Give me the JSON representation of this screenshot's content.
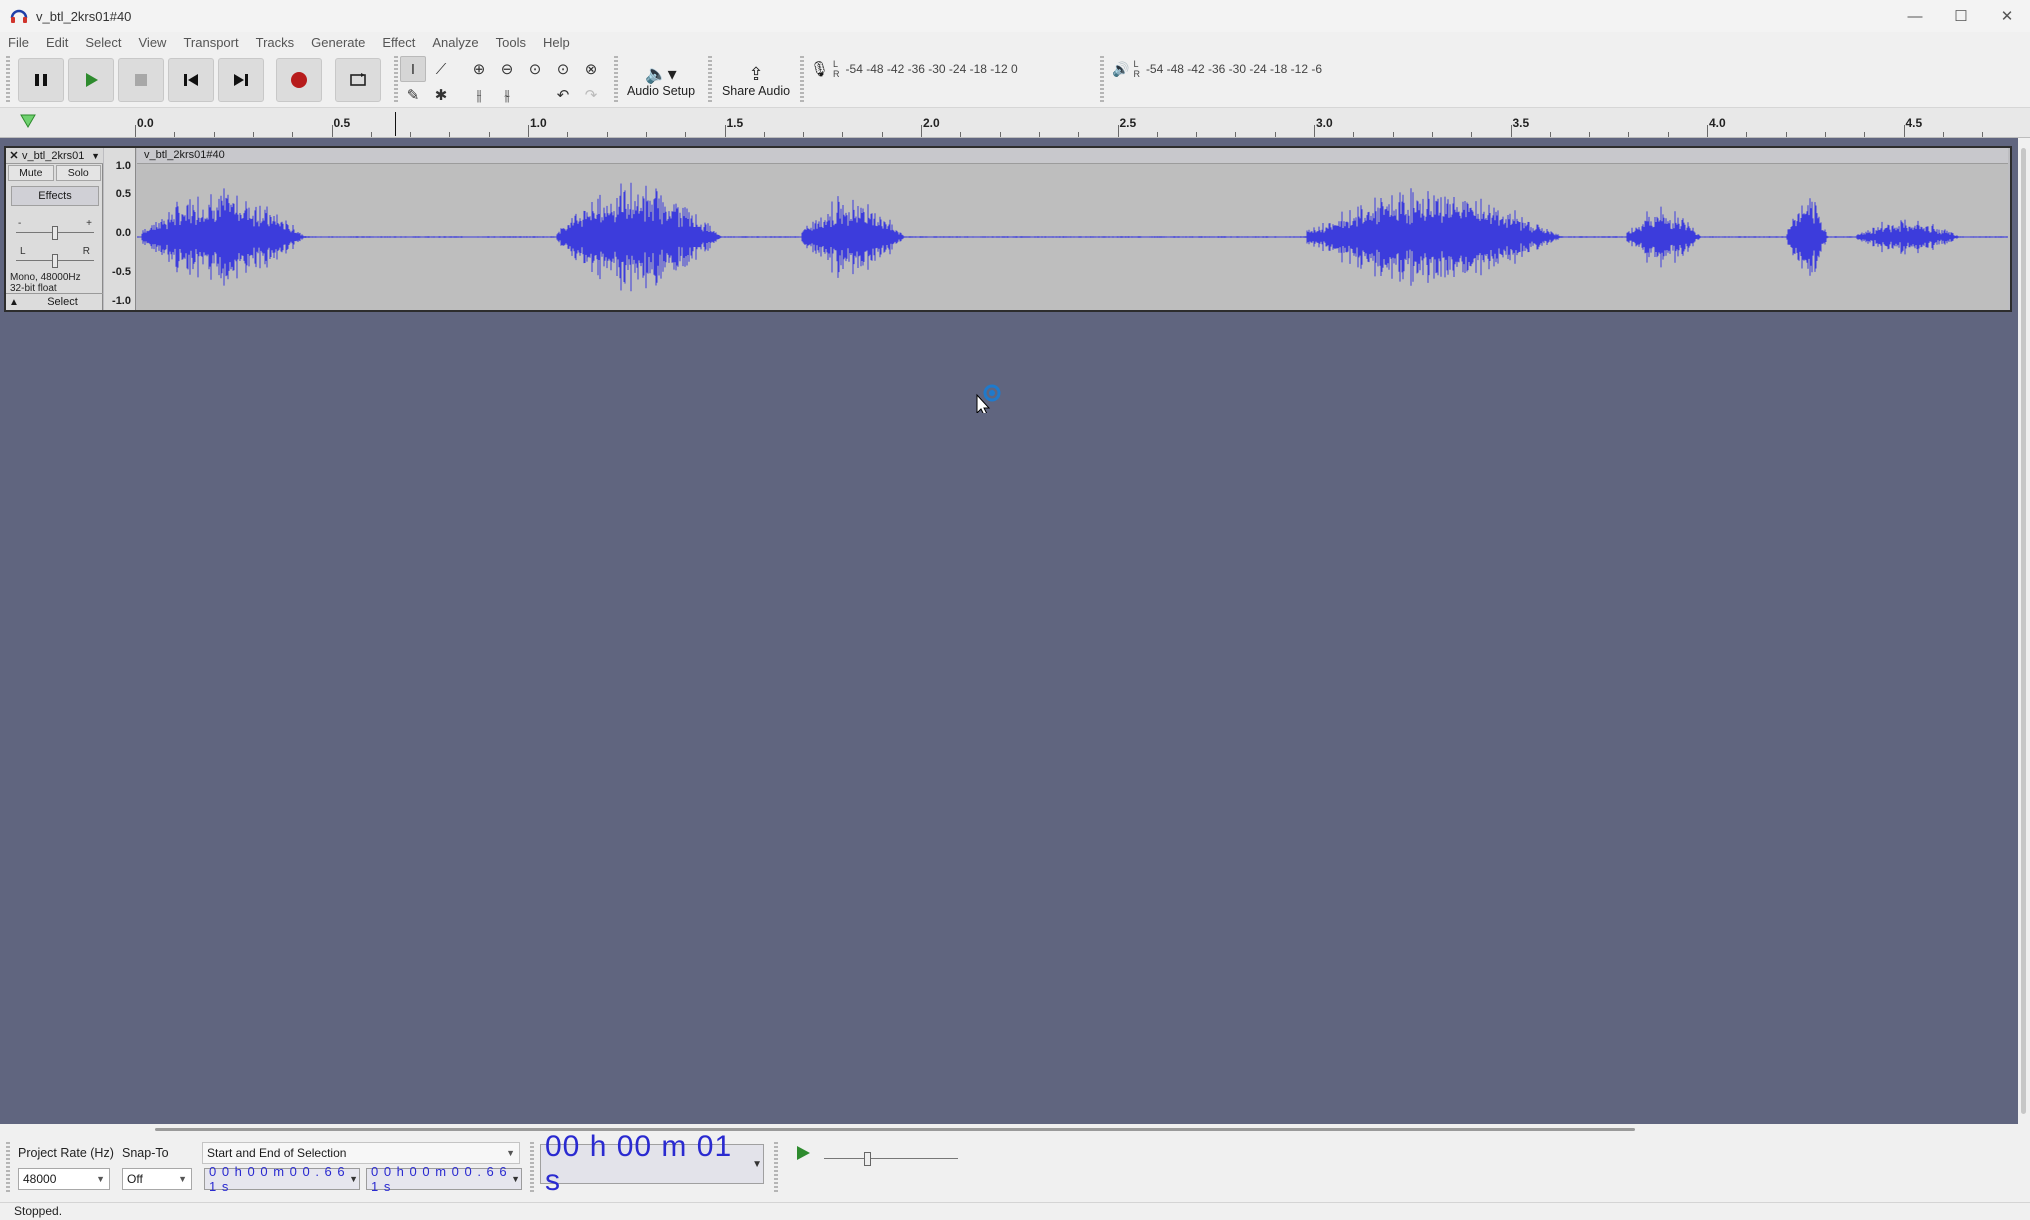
{
  "window": {
    "title": "v_btl_2krs01#40",
    "controls": [
      "—",
      "☐",
      "✕"
    ]
  },
  "menu": [
    "File",
    "Edit",
    "Select",
    "View",
    "Transport",
    "Tracks",
    "Generate",
    "Effect",
    "Analyze",
    "Tools",
    "Help"
  ],
  "toolbar": {
    "audio_setup_label": "Audio Setup",
    "share_audio_label": "Share Audio",
    "record_meter_scale": "-54  -48  -42  -36  -30  -24  -18  -12      0",
    "playback_meter_scale": "-54  -48  -42  -36  -30  -24  -18  -12   -6",
    "meter_l": "L",
    "meter_r": "R",
    "colors": {
      "record": "#b71c1c",
      "play": "#2e8b2e",
      "transport_bg": "#dcdcdc"
    }
  },
  "ruler": {
    "labels": [
      "0.0",
      "0.5",
      "1.0",
      "1.5",
      "2.0",
      "2.5",
      "3.0",
      "3.5",
      "4.0",
      "4.5"
    ],
    "playhead_seconds": 0.661
  },
  "track": {
    "name": "v_btl_2krs01",
    "clip_name": "v_btl_2krs01#40",
    "mute_label": "Mute",
    "solo_label": "Solo",
    "effects_label": "Effects",
    "gain_minus": "-",
    "gain_plus": "+",
    "pan_left": "L",
    "pan_right": "R",
    "info_line1": "Mono, 48000Hz",
    "info_line2": "32-bit float",
    "select_label": "Select",
    "amplitude_labels": [
      "1.0",
      "0.5",
      "0.0",
      "-0.5",
      "-1.0"
    ],
    "waveform_color": "#3c3cdc"
  },
  "bottom": {
    "project_rate_label": "Project Rate (Hz)",
    "project_rate_value": "48000",
    "snap_to_label": "Snap-To",
    "snap_to_value": "Off",
    "selection_mode": "Start and End of Selection",
    "selection_start": "0 0 h 0 0 m 0 0 . 6 6 1 s",
    "selection_end": "0 0 h 0 0 m 0 0 . 6 6 1 s",
    "time_display": "00 h 00 m 01 s"
  },
  "status": "Stopped."
}
